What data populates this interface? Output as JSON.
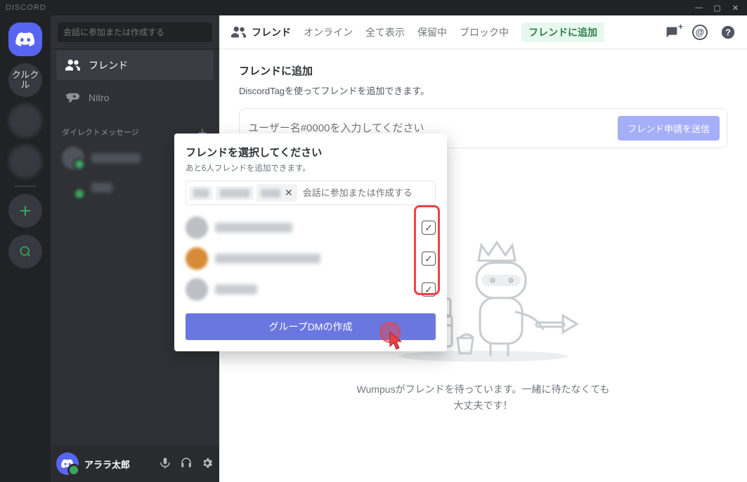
{
  "app": {
    "name": "DISCORD"
  },
  "window_controls": {
    "min": "—",
    "max": "▢",
    "close": "✕"
  },
  "servers": {
    "guild_initials": "クルクル",
    "unknown1": "",
    "unknown2": ""
  },
  "sidebar": {
    "search_placeholder": "会話に参加または作成する",
    "items": {
      "friends": "フレンド",
      "nitro": "Nitro"
    },
    "dm_header": "ダイレクトメッセージ",
    "dm_add": "＋"
  },
  "user_panel": {
    "username": "アララ太郎"
  },
  "topbar": {
    "title": "フレンド",
    "tabs": {
      "online": "オンライン",
      "all": "全て表示",
      "pending": "保留中",
      "blocked": "ブロック中",
      "add": "フレンドに追加"
    },
    "mentions": "@"
  },
  "add_friend": {
    "heading": "フレンドに追加",
    "desc": "DiscordTagを使ってフレンドを追加できます。",
    "placeholder": "ユーザー名#0000を入力してください",
    "button": "フレンド申請を送信"
  },
  "wumpus": {
    "caption": "Wumpusがフレンドを待っています。一緒に待たなくても大丈夫です！"
  },
  "popover": {
    "title": "フレンドを選択してください",
    "sub": "あと6人フレンドを追加できます。",
    "input_placeholder": "会話に参加または作成する",
    "chip_remove": "✕",
    "create_button": "グループDMの作成",
    "friends": [
      {
        "checked": true
      },
      {
        "checked": true
      },
      {
        "checked": true
      }
    ],
    "chips": [
      {},
      {},
      {}
    ]
  }
}
